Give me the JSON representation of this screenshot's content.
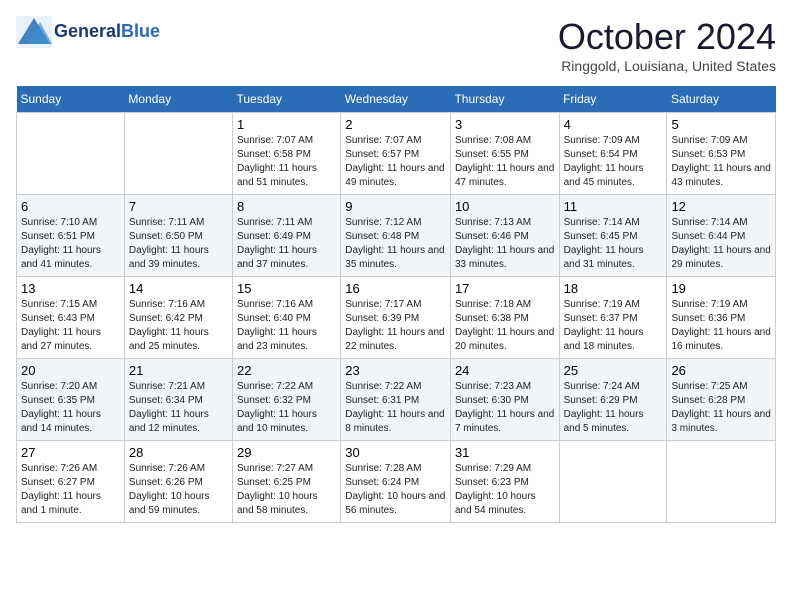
{
  "logo": {
    "line1": "General",
    "line2": "Blue",
    "tagline": ""
  },
  "title": "October 2024",
  "location": "Ringgold, Louisiana, United States",
  "days_of_week": [
    "Sunday",
    "Monday",
    "Tuesday",
    "Wednesday",
    "Thursday",
    "Friday",
    "Saturday"
  ],
  "weeks": [
    [
      {
        "day": "",
        "content": ""
      },
      {
        "day": "",
        "content": ""
      },
      {
        "day": "1",
        "content": "Sunrise: 7:07 AM\nSunset: 6:58 PM\nDaylight: 11 hours and 51 minutes."
      },
      {
        "day": "2",
        "content": "Sunrise: 7:07 AM\nSunset: 6:57 PM\nDaylight: 11 hours and 49 minutes."
      },
      {
        "day": "3",
        "content": "Sunrise: 7:08 AM\nSunset: 6:55 PM\nDaylight: 11 hours and 47 minutes."
      },
      {
        "day": "4",
        "content": "Sunrise: 7:09 AM\nSunset: 6:54 PM\nDaylight: 11 hours and 45 minutes."
      },
      {
        "day": "5",
        "content": "Sunrise: 7:09 AM\nSunset: 6:53 PM\nDaylight: 11 hours and 43 minutes."
      }
    ],
    [
      {
        "day": "6",
        "content": "Sunrise: 7:10 AM\nSunset: 6:51 PM\nDaylight: 11 hours and 41 minutes."
      },
      {
        "day": "7",
        "content": "Sunrise: 7:11 AM\nSunset: 6:50 PM\nDaylight: 11 hours and 39 minutes."
      },
      {
        "day": "8",
        "content": "Sunrise: 7:11 AM\nSunset: 6:49 PM\nDaylight: 11 hours and 37 minutes."
      },
      {
        "day": "9",
        "content": "Sunrise: 7:12 AM\nSunset: 6:48 PM\nDaylight: 11 hours and 35 minutes."
      },
      {
        "day": "10",
        "content": "Sunrise: 7:13 AM\nSunset: 6:46 PM\nDaylight: 11 hours and 33 minutes."
      },
      {
        "day": "11",
        "content": "Sunrise: 7:14 AM\nSunset: 6:45 PM\nDaylight: 11 hours and 31 minutes."
      },
      {
        "day": "12",
        "content": "Sunrise: 7:14 AM\nSunset: 6:44 PM\nDaylight: 11 hours and 29 minutes."
      }
    ],
    [
      {
        "day": "13",
        "content": "Sunrise: 7:15 AM\nSunset: 6:43 PM\nDaylight: 11 hours and 27 minutes."
      },
      {
        "day": "14",
        "content": "Sunrise: 7:16 AM\nSunset: 6:42 PM\nDaylight: 11 hours and 25 minutes."
      },
      {
        "day": "15",
        "content": "Sunrise: 7:16 AM\nSunset: 6:40 PM\nDaylight: 11 hours and 23 minutes."
      },
      {
        "day": "16",
        "content": "Sunrise: 7:17 AM\nSunset: 6:39 PM\nDaylight: 11 hours and 22 minutes."
      },
      {
        "day": "17",
        "content": "Sunrise: 7:18 AM\nSunset: 6:38 PM\nDaylight: 11 hours and 20 minutes."
      },
      {
        "day": "18",
        "content": "Sunrise: 7:19 AM\nSunset: 6:37 PM\nDaylight: 11 hours and 18 minutes."
      },
      {
        "day": "19",
        "content": "Sunrise: 7:19 AM\nSunset: 6:36 PM\nDaylight: 11 hours and 16 minutes."
      }
    ],
    [
      {
        "day": "20",
        "content": "Sunrise: 7:20 AM\nSunset: 6:35 PM\nDaylight: 11 hours and 14 minutes."
      },
      {
        "day": "21",
        "content": "Sunrise: 7:21 AM\nSunset: 6:34 PM\nDaylight: 11 hours and 12 minutes."
      },
      {
        "day": "22",
        "content": "Sunrise: 7:22 AM\nSunset: 6:32 PM\nDaylight: 11 hours and 10 minutes."
      },
      {
        "day": "23",
        "content": "Sunrise: 7:22 AM\nSunset: 6:31 PM\nDaylight: 11 hours and 8 minutes."
      },
      {
        "day": "24",
        "content": "Sunrise: 7:23 AM\nSunset: 6:30 PM\nDaylight: 11 hours and 7 minutes."
      },
      {
        "day": "25",
        "content": "Sunrise: 7:24 AM\nSunset: 6:29 PM\nDaylight: 11 hours and 5 minutes."
      },
      {
        "day": "26",
        "content": "Sunrise: 7:25 AM\nSunset: 6:28 PM\nDaylight: 11 hours and 3 minutes."
      }
    ],
    [
      {
        "day": "27",
        "content": "Sunrise: 7:26 AM\nSunset: 6:27 PM\nDaylight: 11 hours and 1 minute."
      },
      {
        "day": "28",
        "content": "Sunrise: 7:26 AM\nSunset: 6:26 PM\nDaylight: 10 hours and 59 minutes."
      },
      {
        "day": "29",
        "content": "Sunrise: 7:27 AM\nSunset: 6:25 PM\nDaylight: 10 hours and 58 minutes."
      },
      {
        "day": "30",
        "content": "Sunrise: 7:28 AM\nSunset: 6:24 PM\nDaylight: 10 hours and 56 minutes."
      },
      {
        "day": "31",
        "content": "Sunrise: 7:29 AM\nSunset: 6:23 PM\nDaylight: 10 hours and 54 minutes."
      },
      {
        "day": "",
        "content": ""
      },
      {
        "day": "",
        "content": ""
      }
    ]
  ]
}
